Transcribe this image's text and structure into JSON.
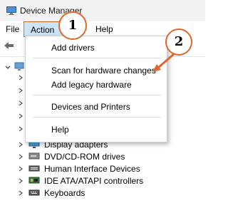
{
  "window": {
    "title": "Device Manager"
  },
  "menubar": {
    "file": "File",
    "action": "Action",
    "help": "Help"
  },
  "action_menu": {
    "items": [
      {
        "label": "Add drivers"
      },
      {
        "label": "Scan for hardware changes"
      },
      {
        "label": "Add legacy hardware"
      },
      {
        "label": "Devices and Printers"
      },
      {
        "label": "Help"
      }
    ]
  },
  "tree": {
    "items": [
      {
        "label": "Display adapters",
        "icon": "monitor-icon"
      },
      {
        "label": "DVD/CD-ROM drives",
        "icon": "disc-drive-icon"
      },
      {
        "label": "Human Interface Devices",
        "icon": "hid-icon"
      },
      {
        "label": "IDE ATA/ATAPI controllers",
        "icon": "ide-controller-icon"
      },
      {
        "label": "Keyboards",
        "icon": "keyboard-icon"
      }
    ]
  },
  "annotations": {
    "step1": "1",
    "step2": "2"
  },
  "colors": {
    "accent_orange": "#e0662e",
    "menu_highlight": "#cce4f7"
  }
}
